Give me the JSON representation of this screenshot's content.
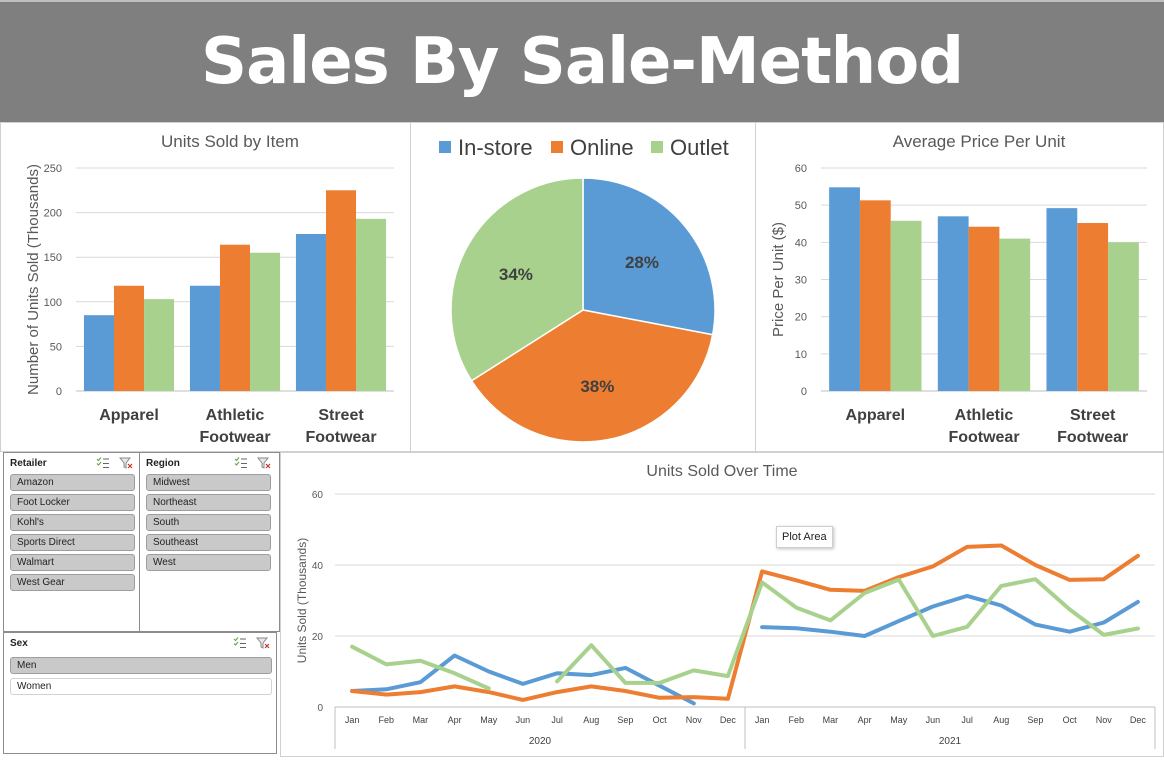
{
  "header": {
    "title": "Sales By Sale-Method"
  },
  "colors": {
    "in_store": "#5b9bd5",
    "online": "#ed7d31",
    "outlet": "#a9d18e",
    "banner": "#7f7f7f"
  },
  "chart_data": [
    {
      "type": "bar",
      "title": "Units Sold by Item",
      "ylabel": "Number of Units Sold (Thousands)",
      "categories": [
        [
          "Apparel"
        ],
        [
          "Athletic",
          "Footwear"
        ],
        [
          "Street",
          "Footwear"
        ]
      ],
      "ylim": [
        0,
        250
      ],
      "yticks": [
        0,
        50,
        100,
        150,
        200,
        250
      ],
      "grid": true,
      "series": [
        {
          "name": "In-store",
          "values": [
            85,
            118,
            176
          ]
        },
        {
          "name": "Online",
          "values": [
            118,
            164,
            225
          ]
        },
        {
          "name": "Outlet",
          "values": [
            103,
            155,
            193
          ]
        }
      ]
    },
    {
      "type": "pie",
      "legend": [
        "In-store",
        "Online",
        "Outlet"
      ],
      "legend_position": "top",
      "slices": [
        {
          "name": "In-store",
          "value": 28,
          "label": "28%"
        },
        {
          "name": "Online",
          "value": 38,
          "label": "38%"
        },
        {
          "name": "Outlet",
          "value": 34,
          "label": "34%"
        }
      ]
    },
    {
      "type": "bar",
      "title": "Average Price Per Unit",
      "ylabel": "Price Per Unit ($)",
      "categories": [
        [
          "Apparel"
        ],
        [
          "Athletic",
          "Footwear"
        ],
        [
          "Street",
          "Footwear"
        ]
      ],
      "ylim": [
        0,
        60
      ],
      "yticks": [
        0,
        10,
        20,
        30,
        40,
        50,
        60
      ],
      "grid": true,
      "series": [
        {
          "name": "In-store",
          "values": [
            54.8,
            47,
            49.2
          ]
        },
        {
          "name": "Online",
          "values": [
            51.3,
            44.2,
            45.2
          ]
        },
        {
          "name": "Outlet",
          "values": [
            45.8,
            41,
            40
          ]
        }
      ]
    },
    {
      "type": "line",
      "title": "Units Sold Over Time",
      "ylabel": "Units Sold (Thousands)",
      "ylim": [
        0,
        60
      ],
      "yticks": [
        0,
        20,
        40,
        60
      ],
      "grid": true,
      "x": [
        "Jan",
        "Feb",
        "Mar",
        "Apr",
        "May",
        "Jun",
        "Jul",
        "Aug",
        "Sep",
        "Oct",
        "Nov",
        "Dec",
        "Jan",
        "Feb",
        "Mar",
        "Apr",
        "May",
        "Jun",
        "Jul",
        "Aug",
        "Sep",
        "Oct",
        "Nov",
        "Dec"
      ],
      "years": [
        "2020",
        "2021"
      ],
      "series": [
        {
          "name": "In-store",
          "values": [
            4.5,
            5,
            7,
            14.5,
            10,
            6.5,
            9.5,
            9,
            11,
            6,
            1,
            null,
            22.5,
            22.2,
            21.2,
            20,
            24.2,
            28.3,
            31.3,
            28.6,
            23.2,
            21.2,
            23.8,
            29.6
          ]
        },
        {
          "name": "Online",
          "values": [
            4.5,
            3.5,
            4.2,
            5.8,
            4.2,
            2,
            4.2,
            5.8,
            4.5,
            2.6,
            2.8,
            2.3,
            38.2,
            35.7,
            33,
            32.7,
            36.6,
            39.6,
            45.1,
            45.5,
            40,
            35.8,
            36,
            42.6
          ]
        },
        {
          "name": "Outlet",
          "values": [
            17,
            12,
            13,
            9.5,
            5.2,
            null,
            7.2,
            17.4,
            6.8,
            6.8,
            10.3,
            8.7,
            35.1,
            28,
            24.4,
            32.1,
            35.9,
            20,
            22.6,
            34.1,
            36,
            27.5,
            20.3,
            22.1
          ]
        }
      ]
    }
  ],
  "slicers": {
    "retailer": {
      "title": "Retailer",
      "items": [
        "Amazon",
        "Foot Locker",
        "Kohl's",
        "Sports Direct",
        "Walmart",
        "West Gear"
      ]
    },
    "region": {
      "title": "Region",
      "items": [
        "Midwest",
        "Northeast",
        "South",
        "Southeast",
        "West"
      ]
    },
    "sex": {
      "title": "Sex",
      "items": [
        "Men",
        "Women"
      ]
    }
  },
  "tooltip": {
    "text": "Plot Area"
  }
}
